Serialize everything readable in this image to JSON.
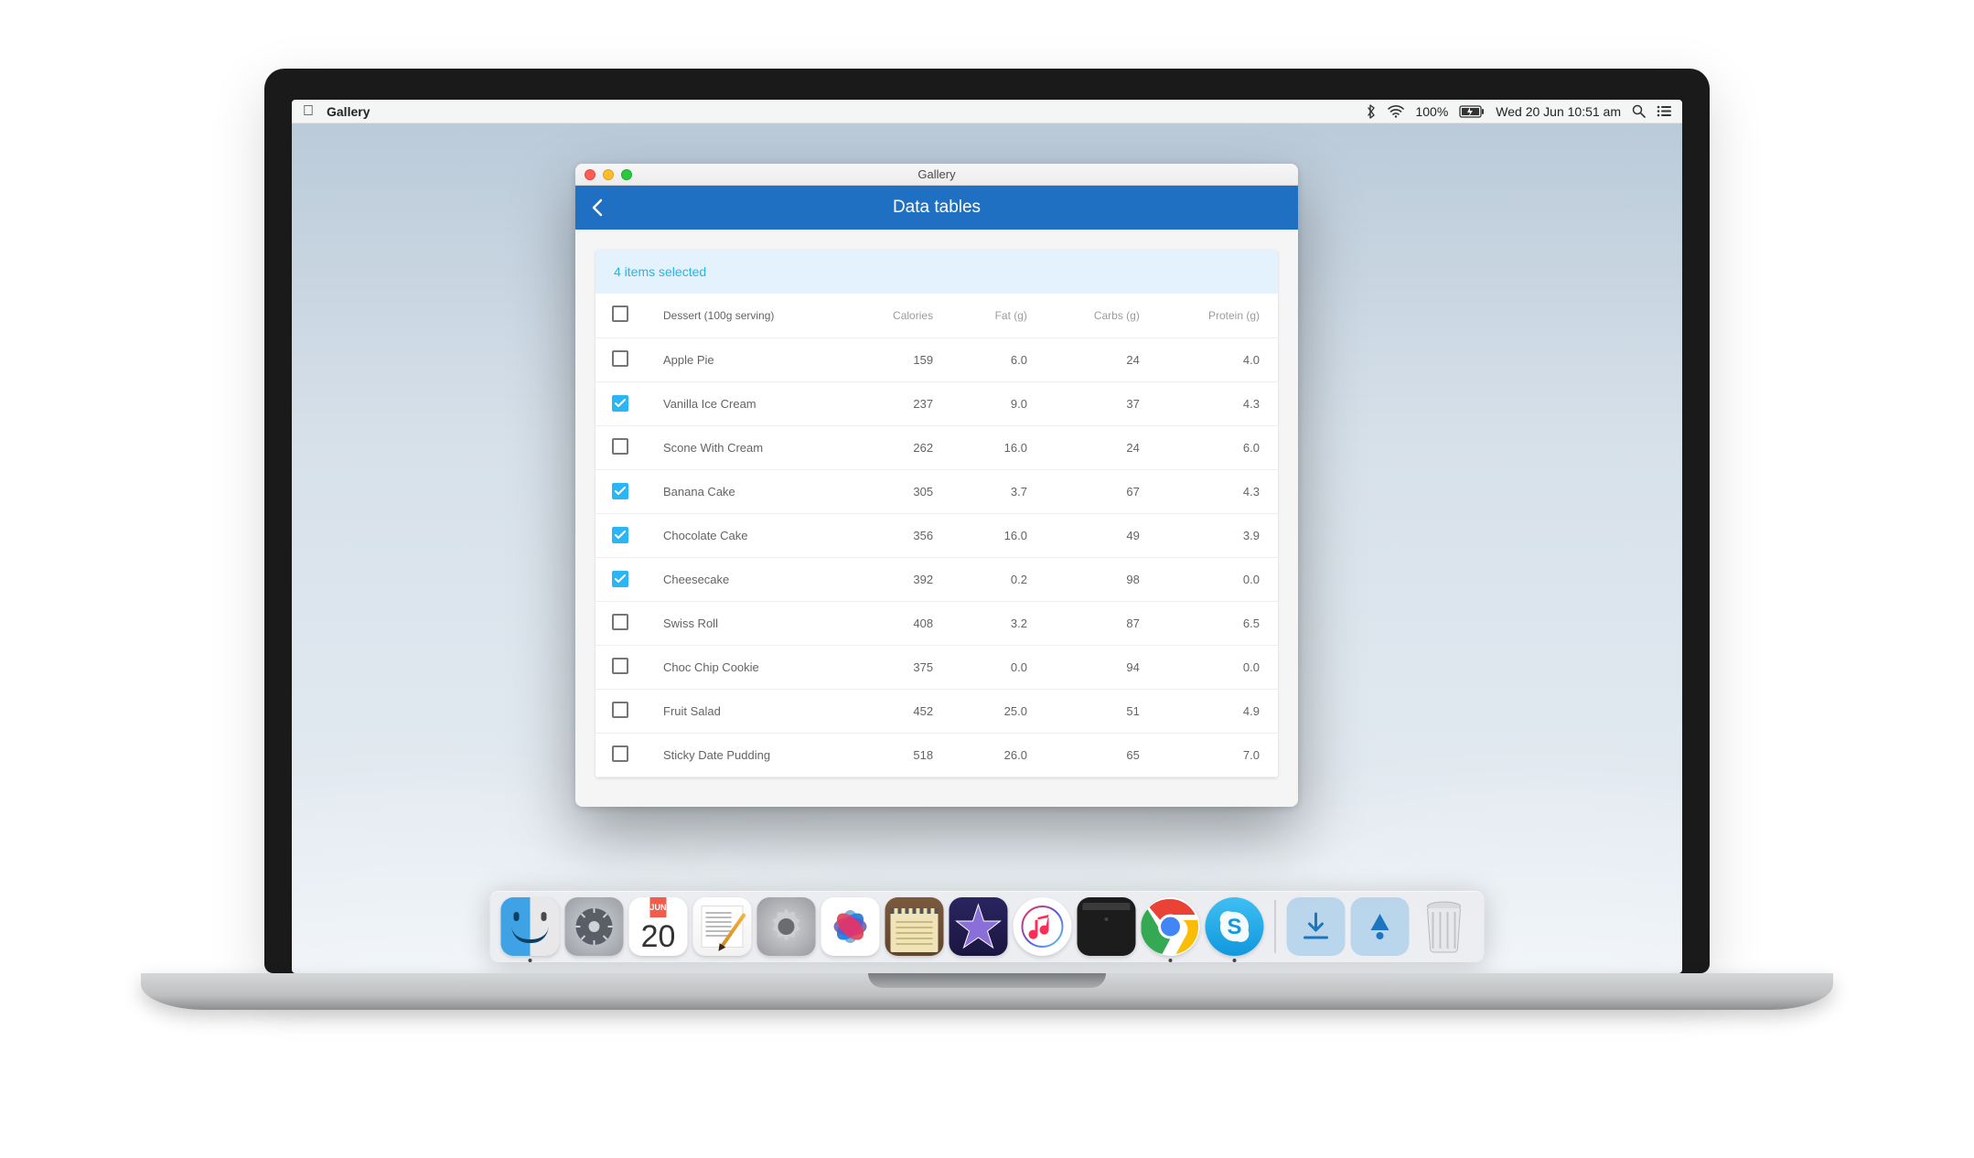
{
  "menubar": {
    "app_name": "Gallery",
    "battery_pct": "100%",
    "datetime": "Wed 20 Jun  10:51 am"
  },
  "window": {
    "title": "Gallery",
    "toolbar_title": "Data tables"
  },
  "table": {
    "selected_summary": "4 items selected",
    "headers": {
      "dessert": "Dessert (100g serving)",
      "calories": "Calories",
      "fat": "Fat (g)",
      "carbs": "Carbs (g)",
      "protein": "Protein (g)"
    },
    "rows": [
      {
        "selected": false,
        "dessert": "Apple Pie",
        "calories": "159",
        "fat": "6.0",
        "carbs": "24",
        "protein": "4.0"
      },
      {
        "selected": true,
        "dessert": "Vanilla Ice Cream",
        "calories": "237",
        "fat": "9.0",
        "carbs": "37",
        "protein": "4.3"
      },
      {
        "selected": false,
        "dessert": "Scone With Cream",
        "calories": "262",
        "fat": "16.0",
        "carbs": "24",
        "protein": "6.0"
      },
      {
        "selected": true,
        "dessert": "Banana Cake",
        "calories": "305",
        "fat": "3.7",
        "carbs": "67",
        "protein": "4.3"
      },
      {
        "selected": true,
        "dessert": "Chocolate Cake",
        "calories": "356",
        "fat": "16.0",
        "carbs": "49",
        "protein": "3.9"
      },
      {
        "selected": true,
        "dessert": "Cheesecake",
        "calories": "392",
        "fat": "0.2",
        "carbs": "98",
        "protein": "0.0"
      },
      {
        "selected": false,
        "dessert": "Swiss Roll",
        "calories": "408",
        "fat": "3.2",
        "carbs": "87",
        "protein": "6.5"
      },
      {
        "selected": false,
        "dessert": "Choc Chip Cookie",
        "calories": "375",
        "fat": "0.0",
        "carbs": "94",
        "protein": "0.0"
      },
      {
        "selected": false,
        "dessert": "Fruit Salad",
        "calories": "452",
        "fat": "25.0",
        "carbs": "51",
        "protein": "4.9"
      },
      {
        "selected": false,
        "dessert": "Sticky Date Pudding",
        "calories": "518",
        "fat": "26.0",
        "carbs": "65",
        "protein": "7.0"
      }
    ]
  },
  "calendar_tile": {
    "month": "JUN",
    "day": "20"
  },
  "dock": [
    {
      "name": "finder",
      "running": true
    },
    {
      "name": "launchpad",
      "running": false
    },
    {
      "name": "calendar",
      "running": true
    },
    {
      "name": "textedit",
      "running": false
    },
    {
      "name": "system-preferences",
      "running": false
    },
    {
      "name": "photos",
      "running": false
    },
    {
      "name": "notes",
      "running": false
    },
    {
      "name": "imovie",
      "running": false
    },
    {
      "name": "itunes",
      "running": false
    },
    {
      "name": "terminal",
      "running": true
    },
    {
      "name": "chrome",
      "running": true
    },
    {
      "name": "skype",
      "running": true
    }
  ]
}
